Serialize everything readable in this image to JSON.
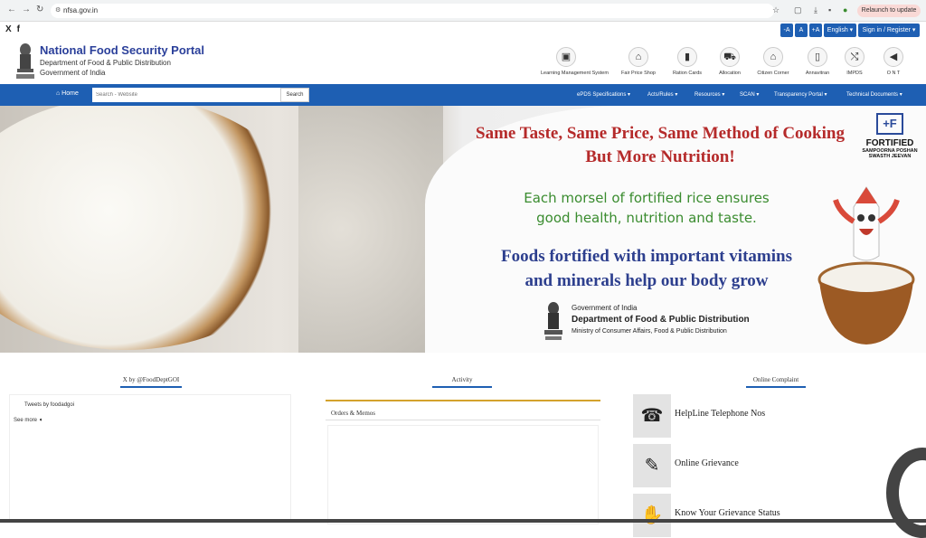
{
  "browser": {
    "url": "nfsa.gov.in",
    "relaunch": "Relaunch to update"
  },
  "topbar": {
    "social": [
      "X",
      "f"
    ],
    "font_buttons": [
      "-A",
      "A",
      "+A"
    ],
    "language": "English ▾",
    "signin": "Sign in / Register ▾"
  },
  "header": {
    "title": "National Food Security Portal",
    "dept": "Department of Food & Public Distribution",
    "gov": "Government of India",
    "links": [
      {
        "label": "Learning Management System",
        "icon": "monitor-icon",
        "glyph": "▣"
      },
      {
        "label": "Fair Price Shop",
        "icon": "shop-icon",
        "glyph": "⌂"
      },
      {
        "label": "Ration Cards",
        "icon": "card-icon",
        "glyph": "▮"
      },
      {
        "label": "Allocation",
        "icon": "truck-icon",
        "glyph": "⛟"
      },
      {
        "label": "Citizen Corner",
        "icon": "house-icon",
        "glyph": "⌂"
      },
      {
        "label": "Annavitran",
        "icon": "device-icon",
        "glyph": "▯"
      },
      {
        "label": "IMPDS",
        "icon": "shuffle-icon",
        "glyph": "⤭"
      },
      {
        "label": "O N T",
        "icon": "megaphone-icon",
        "glyph": "◀"
      }
    ]
  },
  "nav": {
    "home": "⌂ Home",
    "search_placeholder": "Search - Website",
    "search_btn": "Search",
    "menus": [
      "ePDS Specifications ▾",
      "Acts/Rules ▾",
      "Resources ▾",
      "SCAN ▾",
      "Transparency Portal ▾",
      "Technical Documents ▾"
    ]
  },
  "banner": {
    "line1a": "Same Taste, Same Price, Same Method of Cooking",
    "line1b": "But More Nutrition!",
    "line2a": "Each morsel of fortified rice ensures",
    "line2b": "good health, nutrition and taste.",
    "line3a": "Foods fortified with important vitamins",
    "line3b": "and minerals help our body grow",
    "gov1": "Government of India",
    "gov2": "Department of Food & Public Distribution",
    "gov3": "Ministry of Consumer Affairs, Food & Public Distribution",
    "logo_mark": "+F",
    "logo_title": "FORTIFIED",
    "logo_sub1": "SAMPOORNA POSHAN",
    "logo_sub2": "SWASTH JEEVAN"
  },
  "sections": {
    "twitter": "X by @FoodDeptGOI",
    "activity": "Activity",
    "complaint": "Online Complaint",
    "tweets_link": "Tweets by foodadgoi",
    "see_more": "See more ➧",
    "orders": "Orders & Memos"
  },
  "complaints": [
    {
      "label": "HelpLine Telephone Nos",
      "icon": "telephone-icon",
      "glyph": "☎"
    },
    {
      "label": "Online Grievance",
      "icon": "pencil-icon",
      "glyph": "✎"
    },
    {
      "label": "Know Your Grievance Status",
      "icon": "hand-icon",
      "glyph": "✋"
    }
  ]
}
